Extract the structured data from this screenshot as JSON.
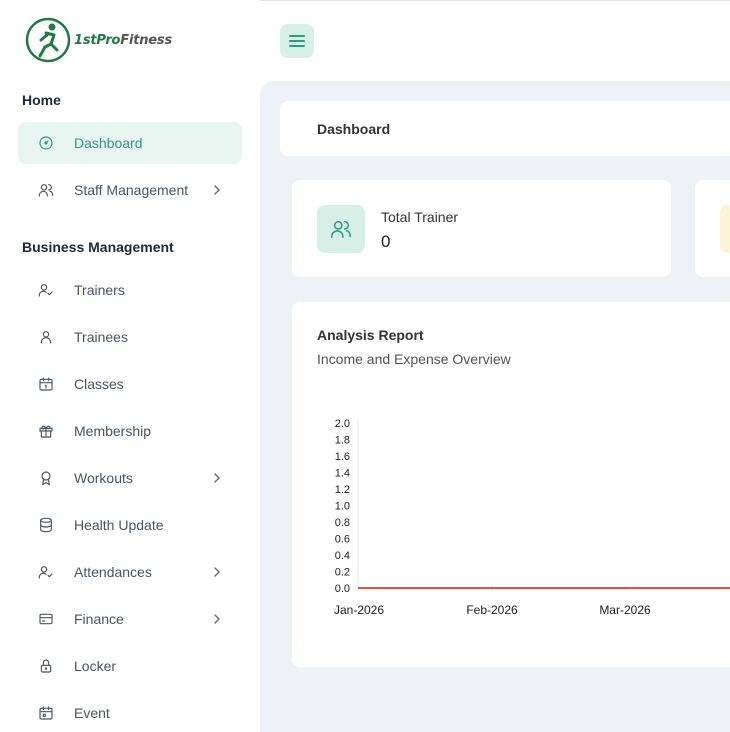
{
  "brand": {
    "name_green": "1stPro",
    "name_gray": "Fitness"
  },
  "sidebar": {
    "home_section": "Home",
    "business_section": "Business Management",
    "items": [
      {
        "label": "Dashboard",
        "icon": "gauge-icon",
        "active": true,
        "has_submenu": false
      },
      {
        "label": "Staff Management",
        "icon": "users-icon",
        "active": false,
        "has_submenu": true
      },
      {
        "label": "Trainers",
        "icon": "user-check-icon",
        "active": false,
        "has_submenu": false
      },
      {
        "label": "Trainees",
        "icon": "user-icon",
        "active": false,
        "has_submenu": false
      },
      {
        "label": "Classes",
        "icon": "calendar-icon",
        "active": false,
        "has_submenu": false
      },
      {
        "label": "Membership",
        "icon": "gift-icon",
        "active": false,
        "has_submenu": false
      },
      {
        "label": "Workouts",
        "icon": "award-icon",
        "active": false,
        "has_submenu": true
      },
      {
        "label": "Health Update",
        "icon": "database-icon",
        "active": false,
        "has_submenu": false
      },
      {
        "label": "Attendances",
        "icon": "user-check-icon",
        "active": false,
        "has_submenu": true
      },
      {
        "label": "Finance",
        "icon": "wallet-icon",
        "active": false,
        "has_submenu": true
      },
      {
        "label": "Locker",
        "icon": "lock-icon",
        "active": false,
        "has_submenu": false
      },
      {
        "label": "Event",
        "icon": "calendar-event-icon",
        "active": false,
        "has_submenu": false
      }
    ]
  },
  "header": {
    "menu_icon": "hamburger-icon"
  },
  "breadcrumb": {
    "title": "Dashboard"
  },
  "stats": [
    {
      "label": "Total Trainer",
      "value": "0",
      "icon": "users-icon"
    }
  ],
  "report": {
    "title": "Analysis Report",
    "subtitle": "Income and Expense Overview"
  },
  "colors": {
    "accent": "#2a9d82",
    "accent_bg": "#e8f5f1",
    "content_bg": "#eef1f5",
    "line": "#e0533d"
  },
  "chart_data": {
    "type": "line",
    "categories": [
      "Jan-2026",
      "Feb-2026",
      "Mar-2026"
    ],
    "y_ticks": [
      "2.0",
      "1.8",
      "1.6",
      "1.4",
      "1.2",
      "1.0",
      "0.8",
      "0.6",
      "0.4",
      "0.2",
      "0.0"
    ],
    "ylim": [
      0,
      2.0
    ],
    "series": [
      {
        "values": [
          0,
          0,
          0
        ],
        "color": "#e0533d"
      }
    ],
    "grid": false
  }
}
